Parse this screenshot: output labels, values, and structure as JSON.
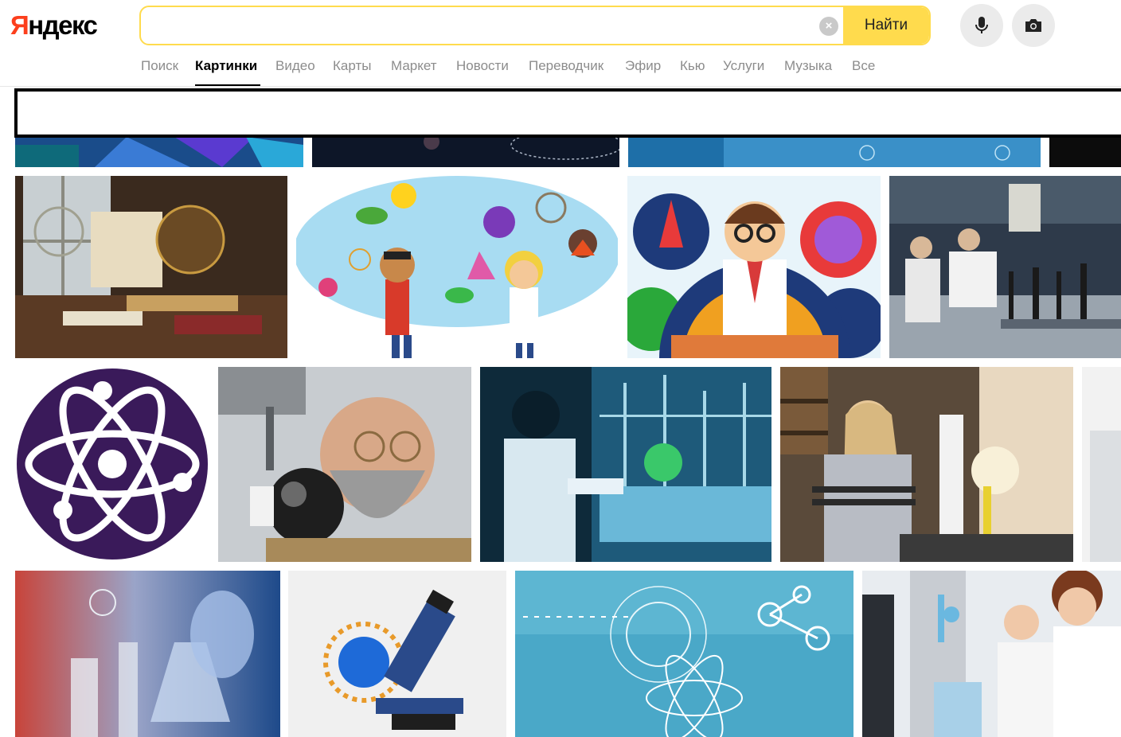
{
  "header": {
    "logo": {
      "first_letter": "Я",
      "rest": "ндекс"
    },
    "search": {
      "value": "",
      "placeholder": "",
      "button_label": "Найти"
    }
  },
  "nav": {
    "tabs": [
      {
        "label": "Поиск"
      },
      {
        "label": "Картинки",
        "active": true
      },
      {
        "label": "Видео"
      },
      {
        "label": "Карты"
      },
      {
        "label": "Маркет"
      },
      {
        "label": "Новости"
      },
      {
        "label": "Переводчик"
      },
      {
        "label": "Эфир"
      },
      {
        "label": "Кью"
      },
      {
        "label": "Услуги"
      },
      {
        "label": "Музыка"
      },
      {
        "label": "Все"
      }
    ]
  },
  "icons": {
    "clear": "close-icon",
    "microphone": "microphone-icon",
    "camera": "camera-icon"
  },
  "colors": {
    "brand_red": "#fc3f1d",
    "accent_yellow": "#ffdb4d",
    "nav_gray": "#8c8c8c"
  }
}
